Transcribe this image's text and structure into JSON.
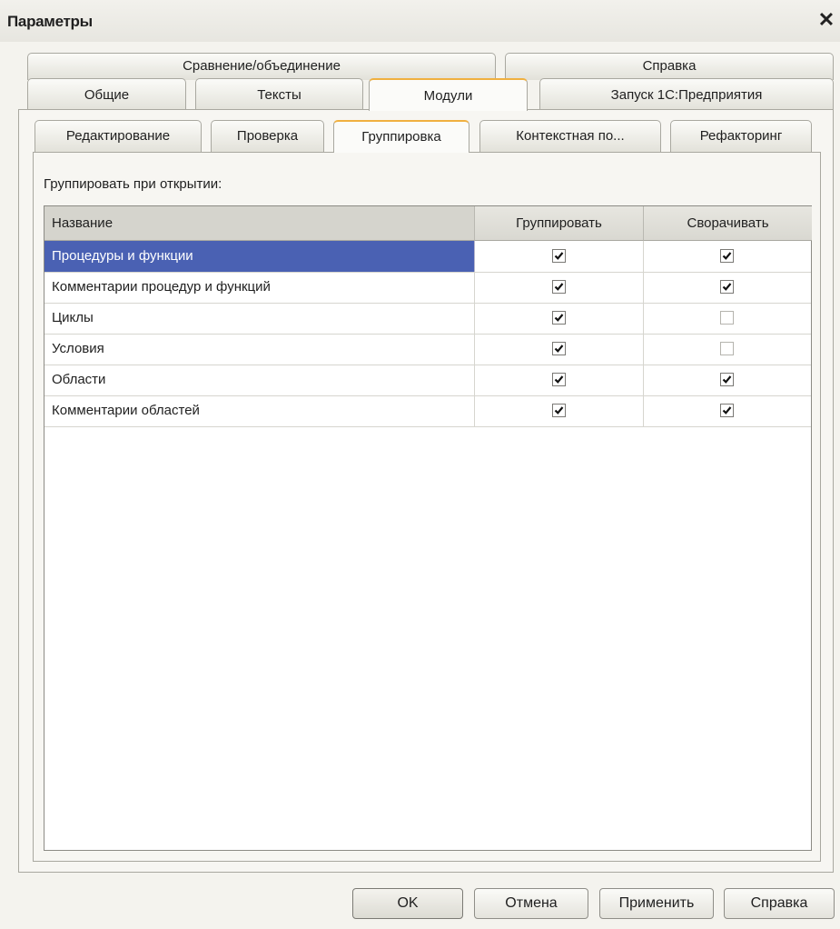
{
  "window": {
    "title": "Параметры",
    "close_glyph": "✕"
  },
  "tabs_row1": [
    {
      "label": "Сравнение/объединение"
    },
    {
      "label": "Справка"
    }
  ],
  "tabs_row2": [
    {
      "label": "Общие"
    },
    {
      "label": "Тексты"
    },
    {
      "label": "Модули",
      "active": true
    },
    {
      "label": "Запуск 1С:Предприятия"
    }
  ],
  "subtabs": [
    {
      "label": "Редактирование"
    },
    {
      "label": "Проверка"
    },
    {
      "label": "Группировка",
      "active": true
    },
    {
      "label": "Контекстная по..."
    },
    {
      "label": "Рефакторинг"
    }
  ],
  "grouping": {
    "caption": "Группировать при открытии:",
    "columns": {
      "name": "Название",
      "group": "Группировать",
      "collapse": "Сворачивать"
    },
    "rows": [
      {
        "name": "Процедуры и функции",
        "group": true,
        "collapse": true,
        "selected": true
      },
      {
        "name": "Комментарии процедур и функций",
        "group": true,
        "collapse": true
      },
      {
        "name": "Циклы",
        "group": true,
        "collapse": false
      },
      {
        "name": "Условия",
        "group": true,
        "collapse": false
      },
      {
        "name": "Области",
        "group": true,
        "collapse": true
      },
      {
        "name": "Комментарии областей",
        "group": true,
        "collapse": true
      }
    ]
  },
  "buttons": {
    "ok": "OK",
    "cancel": "Отмена",
    "apply": "Применить",
    "help": "Справка"
  },
  "colors": {
    "selection": "#4a61b3",
    "active_tab_accent": "#f0b040",
    "window_bg": "#f4f3ee"
  }
}
